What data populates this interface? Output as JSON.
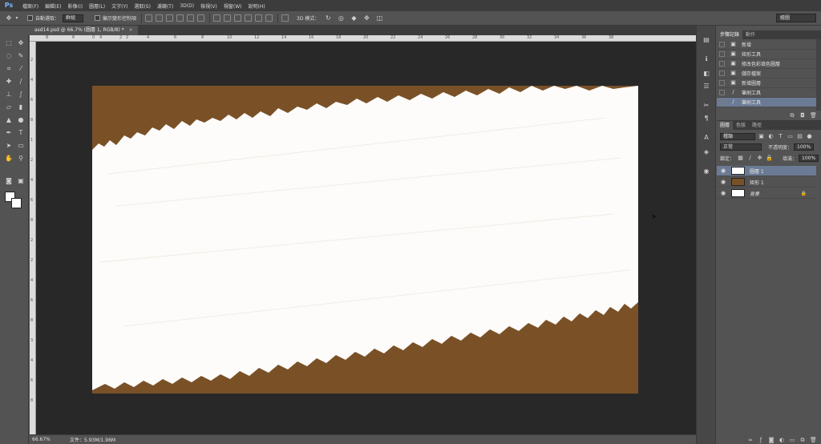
{
  "menubar": {
    "logo": "Ps",
    "items": [
      "檔案(F)",
      "編輯(E)",
      "影像(I)",
      "圖層(L)",
      "文字(Y)",
      "選取(S)",
      "濾鏡(T)",
      "3D(D)",
      "檢視(V)",
      "視窗(W)",
      "說明(H)"
    ]
  },
  "options": {
    "auto_select_label": "自動選取：",
    "auto_select_value": "群組",
    "transform_label": "顯示變形控制項",
    "mode_3d_label": "3D 模式：",
    "workspace": "繪圖"
  },
  "document": {
    "tab_title": "asd14.psd @ 66.7% (圖層 1, RGB/8) *",
    "close_glyph": "×",
    "zoom": "66.67%",
    "info": "文件：5.93M/1.96M",
    "canvas_color": "#7a5127",
    "ruler_top": [
      "8",
      "6",
      "4",
      "2",
      "0",
      "2",
      "4",
      "6",
      "8",
      "10",
      "12",
      "14",
      "16",
      "18",
      "20",
      "22",
      "24",
      "26",
      "28",
      "30",
      "32",
      "34",
      "36",
      "38"
    ],
    "ruler_left": [
      "2",
      "4",
      "6",
      "8",
      "1",
      "2",
      "4",
      "6",
      "8",
      "2",
      "2",
      "4",
      "6",
      "8",
      "3",
      "4",
      "6",
      "8"
    ]
  },
  "history": {
    "tabs": [
      "步驟記錄",
      "動作"
    ],
    "items": [
      {
        "icon": "document-icon",
        "label": "新增"
      },
      {
        "icon": "document-icon",
        "label": "矩形工具"
      },
      {
        "icon": "document-icon",
        "label": "修改色彩填色圖層"
      },
      {
        "icon": "document-icon",
        "label": "儲存檔案"
      },
      {
        "icon": "document-icon",
        "label": "新增圖層"
      },
      {
        "icon": "brush-icon",
        "label": "筆刷工具"
      },
      {
        "icon": "brush-icon",
        "label": "筆刷工具"
      }
    ],
    "selected_index": 6
  },
  "layers": {
    "tabs": [
      "圖層",
      "色版",
      "路徑"
    ],
    "filter_value": "種類",
    "blend_mode": "正常",
    "opacity_label": "不透明度：",
    "opacity_value": "100%",
    "lock_label": "鎖定：",
    "fill_label": "填滿：",
    "fill_value": "100%",
    "items": [
      {
        "name": "圖層 1",
        "thumb_color": "#ffffff",
        "selected": true,
        "locked": false
      },
      {
        "name": "矩形 1",
        "thumb_color": "#7a5127",
        "selected": false,
        "locked": false
      },
      {
        "name": "背景",
        "thumb_color": "#ffffff",
        "selected": false,
        "locked": true
      }
    ],
    "lock_glyph": "🔒",
    "footer_icons": [
      "link-icon",
      "fx-icon",
      "mask-icon",
      "adjustment-icon",
      "folder-icon",
      "new-layer-icon",
      "trash-icon"
    ]
  }
}
